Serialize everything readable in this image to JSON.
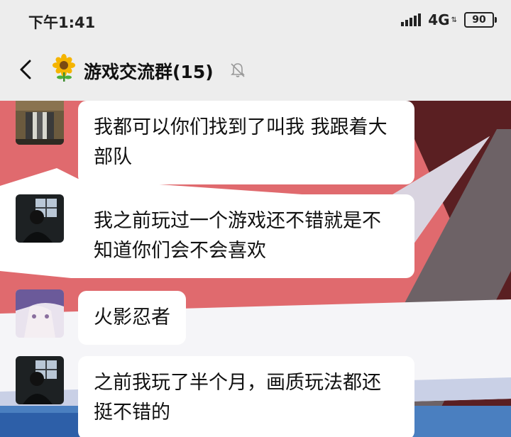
{
  "status_bar": {
    "time": "下午1:41",
    "network": "4G",
    "battery": "90",
    "signal_icon": "signal-bars-icon"
  },
  "header": {
    "title": "游戏交流群(15)",
    "back_icon": "back-chevron-icon",
    "emoji_icon": "sunflower-icon",
    "mute_icon": "mute-bell-icon"
  },
  "messages": [
    {
      "text": "我都可以你们找到了叫我 我跟着大部队"
    },
    {
      "text": "我之前玩过一个游戏还不错就是不知道你们会不会喜欢"
    },
    {
      "text": "火影忍者"
    },
    {
      "text": "之前我玩了半个月，画质玩法都还挺不错的"
    }
  ],
  "colors": {
    "background_pink": "#e06a6e",
    "bubble": "#ffffff"
  }
}
